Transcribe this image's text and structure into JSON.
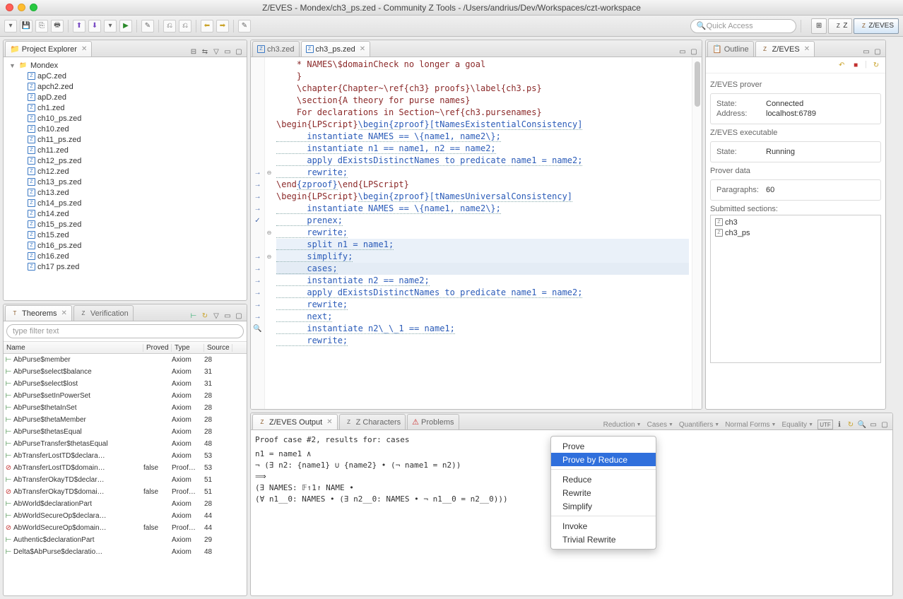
{
  "window_title": "Z/EVES - Mondex/ch3_ps.zed - Community Z Tools - /Users/andrius/Dev/Workspaces/czt-workspace",
  "quick_access_placeholder": "Quick Access",
  "perspectives": [
    "Z",
    "Z/EVES"
  ],
  "project_explorer": {
    "title": "Project Explorer",
    "root": "Mondex",
    "files": [
      "apC.zed",
      "apch2.zed",
      "apD.zed",
      "ch1.zed",
      "ch10_ps.zed",
      "ch10.zed",
      "ch11_ps.zed",
      "ch11.zed",
      "ch12_ps.zed",
      "ch12.zed",
      "ch13_ps.zed",
      "ch13.zed",
      "ch14_ps.zed",
      "ch14.zed",
      "ch15_ps.zed",
      "ch15.zed",
      "ch16_ps.zed",
      "ch16.zed",
      "ch17 ps.zed"
    ]
  },
  "theorems": {
    "title": "Theorems",
    "verification_tab": "Verification",
    "filter_placeholder": "type filter text",
    "cols": [
      "Name",
      "Proved",
      "Type",
      "Source"
    ],
    "rows": [
      {
        "ic": "ok",
        "name": "AbPurse$member",
        "proved": "",
        "type": "Axiom",
        "source": "28"
      },
      {
        "ic": "ok",
        "name": "AbPurse$select$balance",
        "proved": "",
        "type": "Axiom",
        "source": "31"
      },
      {
        "ic": "ok",
        "name": "AbPurse$select$lost",
        "proved": "",
        "type": "Axiom",
        "source": "31"
      },
      {
        "ic": "ok",
        "name": "AbPurse$setInPowerSet",
        "proved": "",
        "type": "Axiom",
        "source": "28"
      },
      {
        "ic": "ok",
        "name": "AbPurse$thetaInSet",
        "proved": "",
        "type": "Axiom",
        "source": "28"
      },
      {
        "ic": "ok",
        "name": "AbPurse$thetaMember",
        "proved": "",
        "type": "Axiom",
        "source": "28"
      },
      {
        "ic": "ok",
        "name": "AbPurse$thetasEqual",
        "proved": "",
        "type": "Axiom",
        "source": "28"
      },
      {
        "ic": "ok",
        "name": "AbPurseTransfer$thetasEqual",
        "proved": "",
        "type": "Axiom",
        "source": "48"
      },
      {
        "ic": "ok",
        "name": "AbTransferLostTD$declara…",
        "proved": "",
        "type": "Axiom",
        "source": "53"
      },
      {
        "ic": "er",
        "name": "AbTransferLostTD$domain…",
        "proved": "false",
        "type": "Proof…",
        "source": "53"
      },
      {
        "ic": "ok",
        "name": "AbTransferOkayTD$declar…",
        "proved": "",
        "type": "Axiom",
        "source": "51"
      },
      {
        "ic": "er",
        "name": "AbTransferOkayTD$domai…",
        "proved": "false",
        "type": "Proof…",
        "source": "51"
      },
      {
        "ic": "ok",
        "name": "AbWorld$declarationPart",
        "proved": "",
        "type": "Axiom",
        "source": "28"
      },
      {
        "ic": "ok",
        "name": "AbWorldSecureOp$declara…",
        "proved": "",
        "type": "Axiom",
        "source": "44"
      },
      {
        "ic": "er",
        "name": "AbWorldSecureOp$domain…",
        "proved": "false",
        "type": "Proof…",
        "source": "44"
      },
      {
        "ic": "ok",
        "name": "Authentic$declarationPart",
        "proved": "",
        "type": "Axiom",
        "source": "29"
      },
      {
        "ic": "ok",
        "name": "Delta$AbPurse$declaratio…",
        "proved": "",
        "type": "Axiom",
        "source": "48"
      }
    ]
  },
  "editors": [
    "ch3.zed",
    "ch3_ps.zed"
  ],
  "active_editor": 1,
  "code_lines": [
    {
      "g": "",
      "f": "",
      "t": "    * NAMES\\$domainCheck no longer a goal",
      "cls": "kw"
    },
    {
      "g": "",
      "f": "",
      "t": "    }",
      "cls": "kw"
    },
    {
      "g": "",
      "f": "",
      "t": ""
    },
    {
      "g": "",
      "f": "",
      "t": "    \\chapter{Chapter~\\ref{ch3} proofs}\\label{ch3.ps}",
      "cls": "kw"
    },
    {
      "g": "",
      "f": "",
      "t": ""
    },
    {
      "g": "",
      "f": "",
      "t": "    \\section{A theory for purse names}",
      "cls": "kw"
    },
    {
      "g": "",
      "f": "",
      "t": ""
    },
    {
      "g": "",
      "f": "",
      "t": "    For declarations in Section~\\ref{ch3.pursenames}",
      "cls": "kw"
    },
    {
      "g": "",
      "f": "",
      "t": ""
    },
    {
      "g": "→",
      "f": "⊖",
      "html": "<span class='kw'>\\begin{LPScript}</span><span class='zp'>\\begin{zproof}[tNamesExistentialConsistency]</span>"
    },
    {
      "g": "→",
      "f": "",
      "t": "      instantiate NAMES == \\{name1, name2\\};",
      "cls": "zp"
    },
    {
      "g": "→",
      "f": "",
      "t": "      instantiate n1 == name1, n2 == name2;",
      "cls": "zp"
    },
    {
      "g": "→",
      "f": "",
      "t": "      apply dExistsDistinctNames to predicate name1 = name2;",
      "cls": "zp"
    },
    {
      "g": "✓",
      "f": "",
      "t": "      rewrite;",
      "cls": "zp"
    },
    {
      "g": "",
      "f": "⊖",
      "html": "<span class='kw'>\\end</span><span class='zp'>{zproof}</span><span class='kw'>\\end{LPScript}</span>"
    },
    {
      "g": "",
      "f": "",
      "t": ""
    },
    {
      "g": "→",
      "f": "⊖",
      "html": "<span class='kw'>\\begin{LPScript}</span><span class='zp'>\\begin{zproof}[tNamesUniversalConsistency]</span>"
    },
    {
      "g": "→",
      "f": "",
      "t": "      instantiate NAMES == \\{name1, name2\\};",
      "cls": "zp"
    },
    {
      "g": "→",
      "f": "",
      "t": "      prenex;",
      "cls": "zp"
    },
    {
      "g": "→",
      "f": "",
      "t": "      rewrite;",
      "cls": "zp"
    },
    {
      "g": "→",
      "f": "",
      "t": "      split n1 = name1;",
      "cls": "zp",
      "hl": "hl2"
    },
    {
      "g": "→",
      "f": "",
      "t": "      simplify;",
      "cls": "zp",
      "hl": "hl2"
    },
    {
      "g": "🔍",
      "f": "",
      "t": "      cases;",
      "cls": "zp",
      "hl": "hl"
    },
    {
      "g": "",
      "f": "",
      "t": "      instantiate n2 == name2;",
      "cls": "zp"
    },
    {
      "g": "",
      "f": "",
      "t": "      apply dExistsDistinctNames to predicate name1 = name2;",
      "cls": "zp"
    },
    {
      "g": "",
      "f": "",
      "t": "      rewrite;",
      "cls": "zp"
    },
    {
      "g": "",
      "f": "",
      "t": "      next;",
      "cls": "zp"
    },
    {
      "g": "",
      "f": "",
      "t": "      instantiate n2\\_\\_1 == name1;",
      "cls": "zp"
    },
    {
      "g": "",
      "f": "",
      "t": "      rewrite;",
      "cls": "zp"
    }
  ],
  "output": {
    "title": "Z/EVES Output",
    "tab2": "Z Characters",
    "tab3": "Problems",
    "reduction_menus": [
      "Reduction",
      "Cases",
      "Quantifiers",
      "Normal Forms",
      "Equality"
    ],
    "header": "Proof case #2, results for: cases",
    "lines": [
      "n1 = name1 ∧",
      "   ¬ (∃ n2: {name1} ∪ {name2} • (¬ name1 = n2))",
      "⟹",
      "(∃ NAMES: 𝔽↿1↾ NAME •",
      "   (∀ n1__0: NAMES • (∃ n2__0: NAMES • ¬ n1__0 = n2__0)))"
    ]
  },
  "context_menu": [
    "Prove",
    "Prove by Reduce",
    "",
    "Reduce",
    "Rewrite",
    "Simplify",
    "",
    "Invoke",
    "Trivial Rewrite"
  ],
  "context_menu_selected": 1,
  "outline": {
    "title_outline": "Outline",
    "title_zeves": "Z/EVES",
    "prover_title": "Z/EVES prover",
    "state_label": "State:",
    "state": "Connected",
    "addr_label": "Address:",
    "addr": "localhost:6789",
    "exec_title": "Z/EVES executable",
    "exec_state_label": "State:",
    "exec_state": "Running",
    "data_title": "Prover data",
    "para_label": "Paragraphs:",
    "para": "60",
    "sections_title": "Submitted sections:",
    "sections": [
      "ch3",
      "ch3_ps"
    ]
  }
}
